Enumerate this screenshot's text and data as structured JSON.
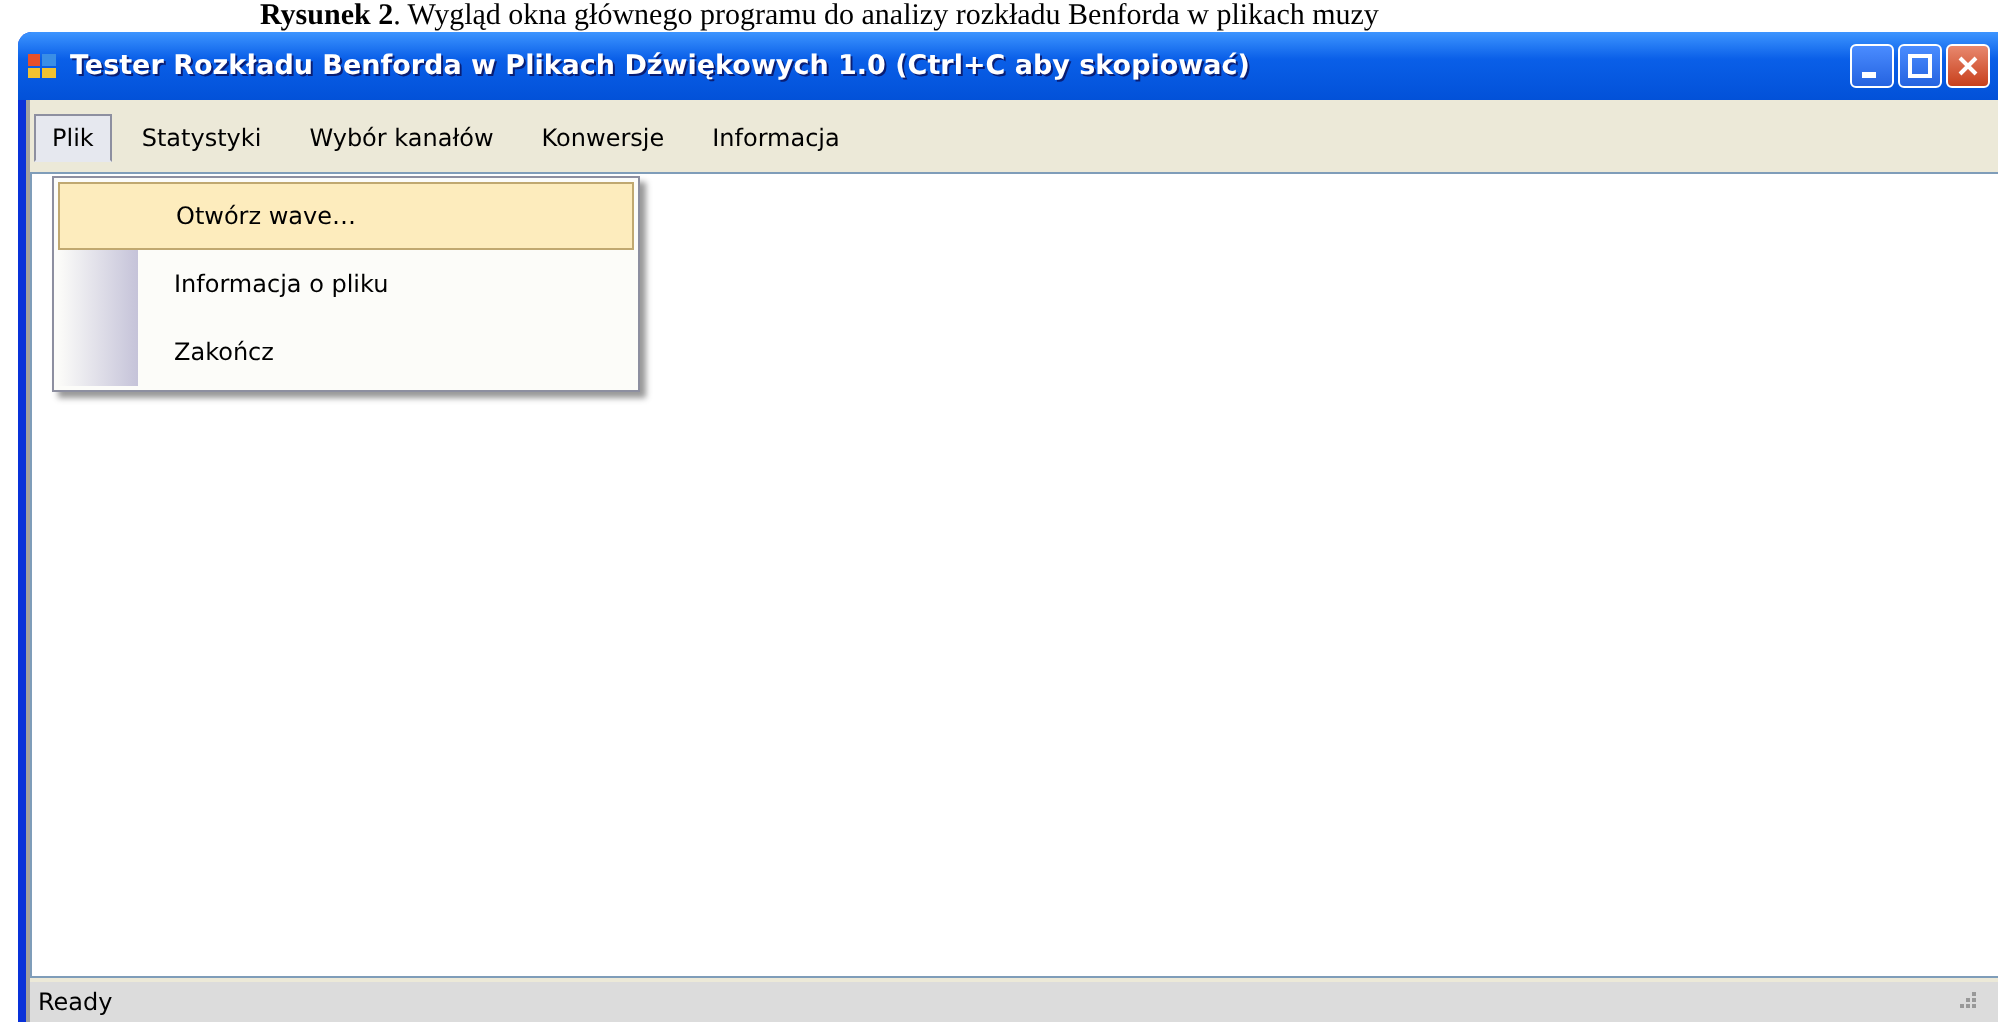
{
  "caption": "**Rysunek 2**. Wygląd okna głównego programu do analizy rozkładu Benforda w plikach muzy",
  "window": {
    "title": "Tester Rozkładu Benforda w Plikach Dźwiękowych 1.0 (Ctrl+C aby skopiować)"
  },
  "menu": [
    {
      "label": "Plik",
      "selected": true
    },
    {
      "label": "Statystyki",
      "selected": false
    },
    {
      "label": "Wybór kanałów",
      "selected": false
    },
    {
      "label": "Konwersje",
      "selected": false
    },
    {
      "label": "Informacja",
      "selected": false
    }
  ],
  "dropdown": [
    {
      "label": "Otwórz wave…",
      "selected": true
    },
    {
      "label": "Informacja o pliku",
      "selected": false
    },
    {
      "label": "Zakończ",
      "selected": false
    }
  ],
  "status_bar": {
    "text": "Ready"
  }
}
